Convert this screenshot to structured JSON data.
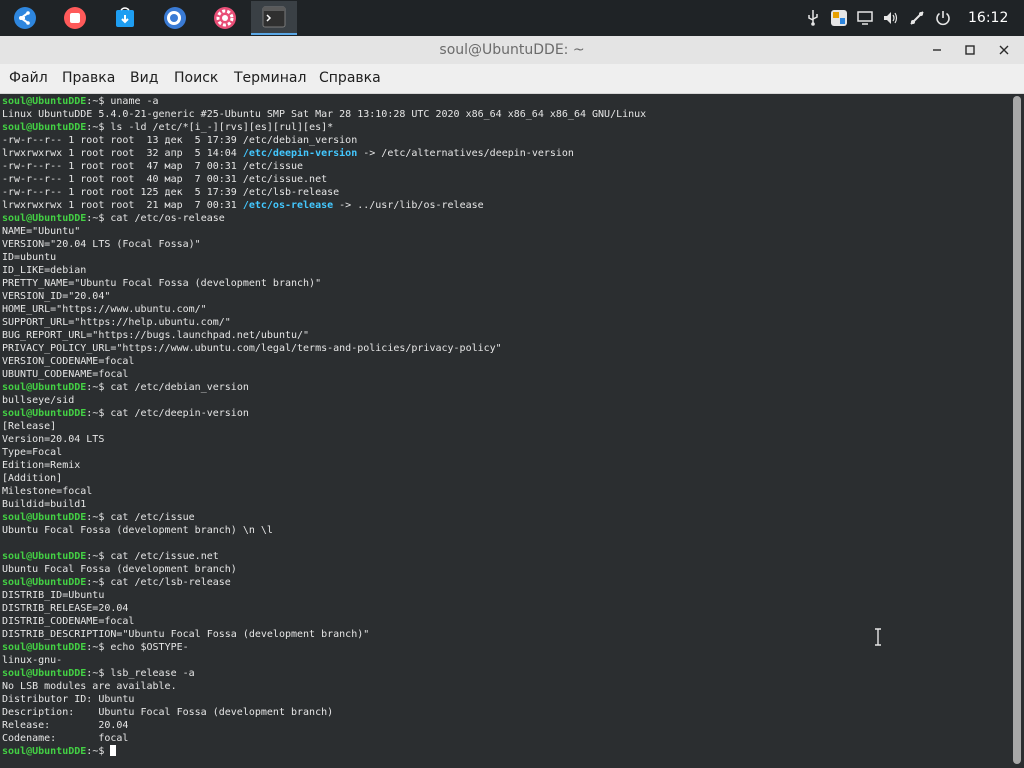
{
  "dock": {
    "apps": [
      {
        "name": "launcher",
        "color": "#2e86de"
      },
      {
        "name": "screen-recorder",
        "color": "#ff5a5a"
      },
      {
        "name": "app-store",
        "color": "#1e9ef2"
      },
      {
        "name": "browser",
        "color": "#3a7bd5"
      },
      {
        "name": "settings",
        "color": "#e94e77"
      },
      {
        "name": "terminal",
        "color": "#2f2f2f"
      }
    ],
    "clock": "16:12"
  },
  "window": {
    "title": "soul@UbuntuDDE: ~",
    "menu": [
      "Файл",
      "Правка",
      "Вид",
      "Поиск",
      "Терминал",
      "Справка"
    ]
  },
  "terminal": {
    "prompt_user": "soul@UbuntuDDE",
    "prompt_tail": ":~$ ",
    "lines": [
      {
        "t": "prompt",
        "cmd": "uname -a"
      },
      {
        "t": "text",
        "text": "Linux UbuntuDDE 5.4.0-21-generic #25-Ubuntu SMP Sat Mar 28 13:10:28 UTC 2020 x86_64 x86_64 x86_64 GNU/Linux"
      },
      {
        "t": "prompt",
        "cmd": "ls -ld /etc/*[i_-][rvs][es][rul][es]*"
      },
      {
        "t": "text",
        "text": "-rw-r--r-- 1 root root  13 дек  5 17:39 /etc/debian_version"
      },
      {
        "t": "link",
        "pre": "lrwxrwxrwx 1 root root  32 апр  5 14:04 ",
        "link": "/etc/deepin-version",
        "post": " -> /etc/alternatives/deepin-version"
      },
      {
        "t": "text",
        "text": "-rw-r--r-- 1 root root  47 мар  7 00:31 /etc/issue"
      },
      {
        "t": "text",
        "text": "-rw-r--r-- 1 root root  40 мар  7 00:31 /etc/issue.net"
      },
      {
        "t": "text",
        "text": "-rw-r--r-- 1 root root 125 дек  5 17:39 /etc/lsb-release"
      },
      {
        "t": "link",
        "pre": "lrwxrwxrwx 1 root root  21 мар  7 00:31 ",
        "link": "/etc/os-release",
        "post": " -> ../usr/lib/os-release"
      },
      {
        "t": "prompt",
        "cmd": "cat /etc/os-release"
      },
      {
        "t": "text",
        "text": "NAME=\"Ubuntu\""
      },
      {
        "t": "text",
        "text": "VERSION=\"20.04 LTS (Focal Fossa)\""
      },
      {
        "t": "text",
        "text": "ID=ubuntu"
      },
      {
        "t": "text",
        "text": "ID_LIKE=debian"
      },
      {
        "t": "text",
        "text": "PRETTY_NAME=\"Ubuntu Focal Fossa (development branch)\""
      },
      {
        "t": "text",
        "text": "VERSION_ID=\"20.04\""
      },
      {
        "t": "text",
        "text": "HOME_URL=\"https://www.ubuntu.com/\""
      },
      {
        "t": "text",
        "text": "SUPPORT_URL=\"https://help.ubuntu.com/\""
      },
      {
        "t": "text",
        "text": "BUG_REPORT_URL=\"https://bugs.launchpad.net/ubuntu/\""
      },
      {
        "t": "text",
        "text": "PRIVACY_POLICY_URL=\"https://www.ubuntu.com/legal/terms-and-policies/privacy-policy\""
      },
      {
        "t": "text",
        "text": "VERSION_CODENAME=focal"
      },
      {
        "t": "text",
        "text": "UBUNTU_CODENAME=focal"
      },
      {
        "t": "prompt",
        "cmd": "cat /etc/debian_version"
      },
      {
        "t": "text",
        "text": "bullseye/sid"
      },
      {
        "t": "prompt",
        "cmd": "cat /etc/deepin-version"
      },
      {
        "t": "text",
        "text": "[Release]"
      },
      {
        "t": "text",
        "text": "Version=20.04 LTS"
      },
      {
        "t": "text",
        "text": "Type=Focal"
      },
      {
        "t": "text",
        "text": "Edition=Remix"
      },
      {
        "t": "text",
        "text": "[Addition]"
      },
      {
        "t": "text",
        "text": "Milestone=focal"
      },
      {
        "t": "text",
        "text": "Buildid=build1"
      },
      {
        "t": "prompt",
        "cmd": "cat /etc/issue"
      },
      {
        "t": "text",
        "text": "Ubuntu Focal Fossa (development branch) \\n \\l"
      },
      {
        "t": "text",
        "text": ""
      },
      {
        "t": "prompt",
        "cmd": "cat /etc/issue.net"
      },
      {
        "t": "text",
        "text": "Ubuntu Focal Fossa (development branch)"
      },
      {
        "t": "prompt",
        "cmd": "cat /etc/lsb-release"
      },
      {
        "t": "text",
        "text": "DISTRIB_ID=Ubuntu"
      },
      {
        "t": "text",
        "text": "DISTRIB_RELEASE=20.04"
      },
      {
        "t": "text",
        "text": "DISTRIB_CODENAME=focal"
      },
      {
        "t": "text",
        "text": "DISTRIB_DESCRIPTION=\"Ubuntu Focal Fossa (development branch)\""
      },
      {
        "t": "prompt",
        "cmd": "echo $OSTYPE-"
      },
      {
        "t": "text",
        "text": "linux-gnu-"
      },
      {
        "t": "prompt",
        "cmd": "lsb_release -a"
      },
      {
        "t": "text",
        "text": "No LSB modules are available."
      },
      {
        "t": "text",
        "text": "Distributor ID: Ubuntu"
      },
      {
        "t": "text",
        "text": "Description:    Ubuntu Focal Fossa (development branch)"
      },
      {
        "t": "text",
        "text": "Release:        20.04"
      },
      {
        "t": "text",
        "text": "Codename:       focal"
      },
      {
        "t": "cursor",
        "cmd": ""
      }
    ]
  }
}
